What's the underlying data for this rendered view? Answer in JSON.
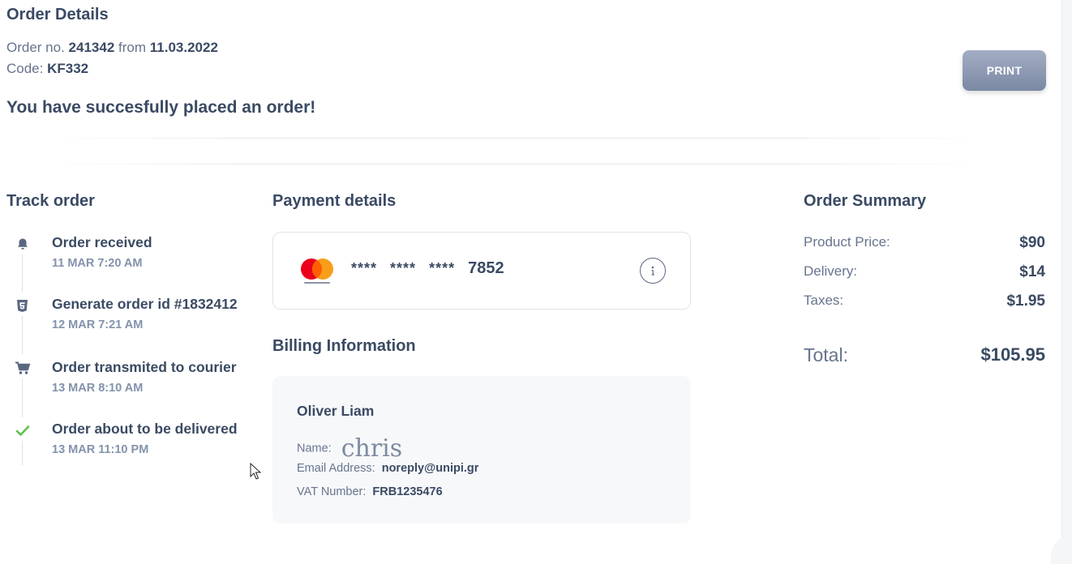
{
  "header": {
    "title": "Order Details",
    "order_prefix": "Order no.",
    "order_number": "241342",
    "order_from": "from",
    "order_date": "11.03.2022",
    "code_label": "Code:",
    "code_value": "KF332",
    "success_message": "You have succesfully placed an order!",
    "print_label": "PRINT"
  },
  "track": {
    "heading": "Track order",
    "steps": [
      {
        "title": "Order received",
        "time": "11 MAR 7:20 AM",
        "icon": "bell-icon"
      },
      {
        "title": "Generate order id #1832412",
        "time": "12 MAR 7:21 AM",
        "icon": "html5-icon"
      },
      {
        "title": "Order transmited to courier",
        "time": "13 MAR 8:10 AM",
        "icon": "cart-icon"
      },
      {
        "title": "Order about to be delivered",
        "time": "13 MAR 11:10 PM",
        "icon": "check-icon"
      }
    ]
  },
  "payment": {
    "heading": "Payment details",
    "card_mask_1": "****",
    "card_mask_2": "****",
    "card_mask_3": "****",
    "card_last4": "7852",
    "card_brand": "mastercard",
    "info_icon": "info-icon"
  },
  "billing": {
    "heading": "Billing Information",
    "name": "Oliver Liam",
    "name_label": "Name:",
    "name_signature": "chris",
    "email_label": "Email Address:",
    "email": "noreply@unipi.gr",
    "vat_label": "VAT Number:",
    "vat": "FRB1235476"
  },
  "summary": {
    "heading": "Order Summary",
    "product_label": "Product Price:",
    "product_value": "$90",
    "delivery_label": "Delivery:",
    "delivery_value": "$14",
    "taxes_label": "Taxes:",
    "taxes_value": "$1.95",
    "total_label": "Total:",
    "total_value": "$105.95"
  },
  "colors": {
    "text_dark": "#3a4a63",
    "text_muted": "#67748e",
    "success_check": "#5fc24a",
    "print_button": "#8f9bb3"
  }
}
